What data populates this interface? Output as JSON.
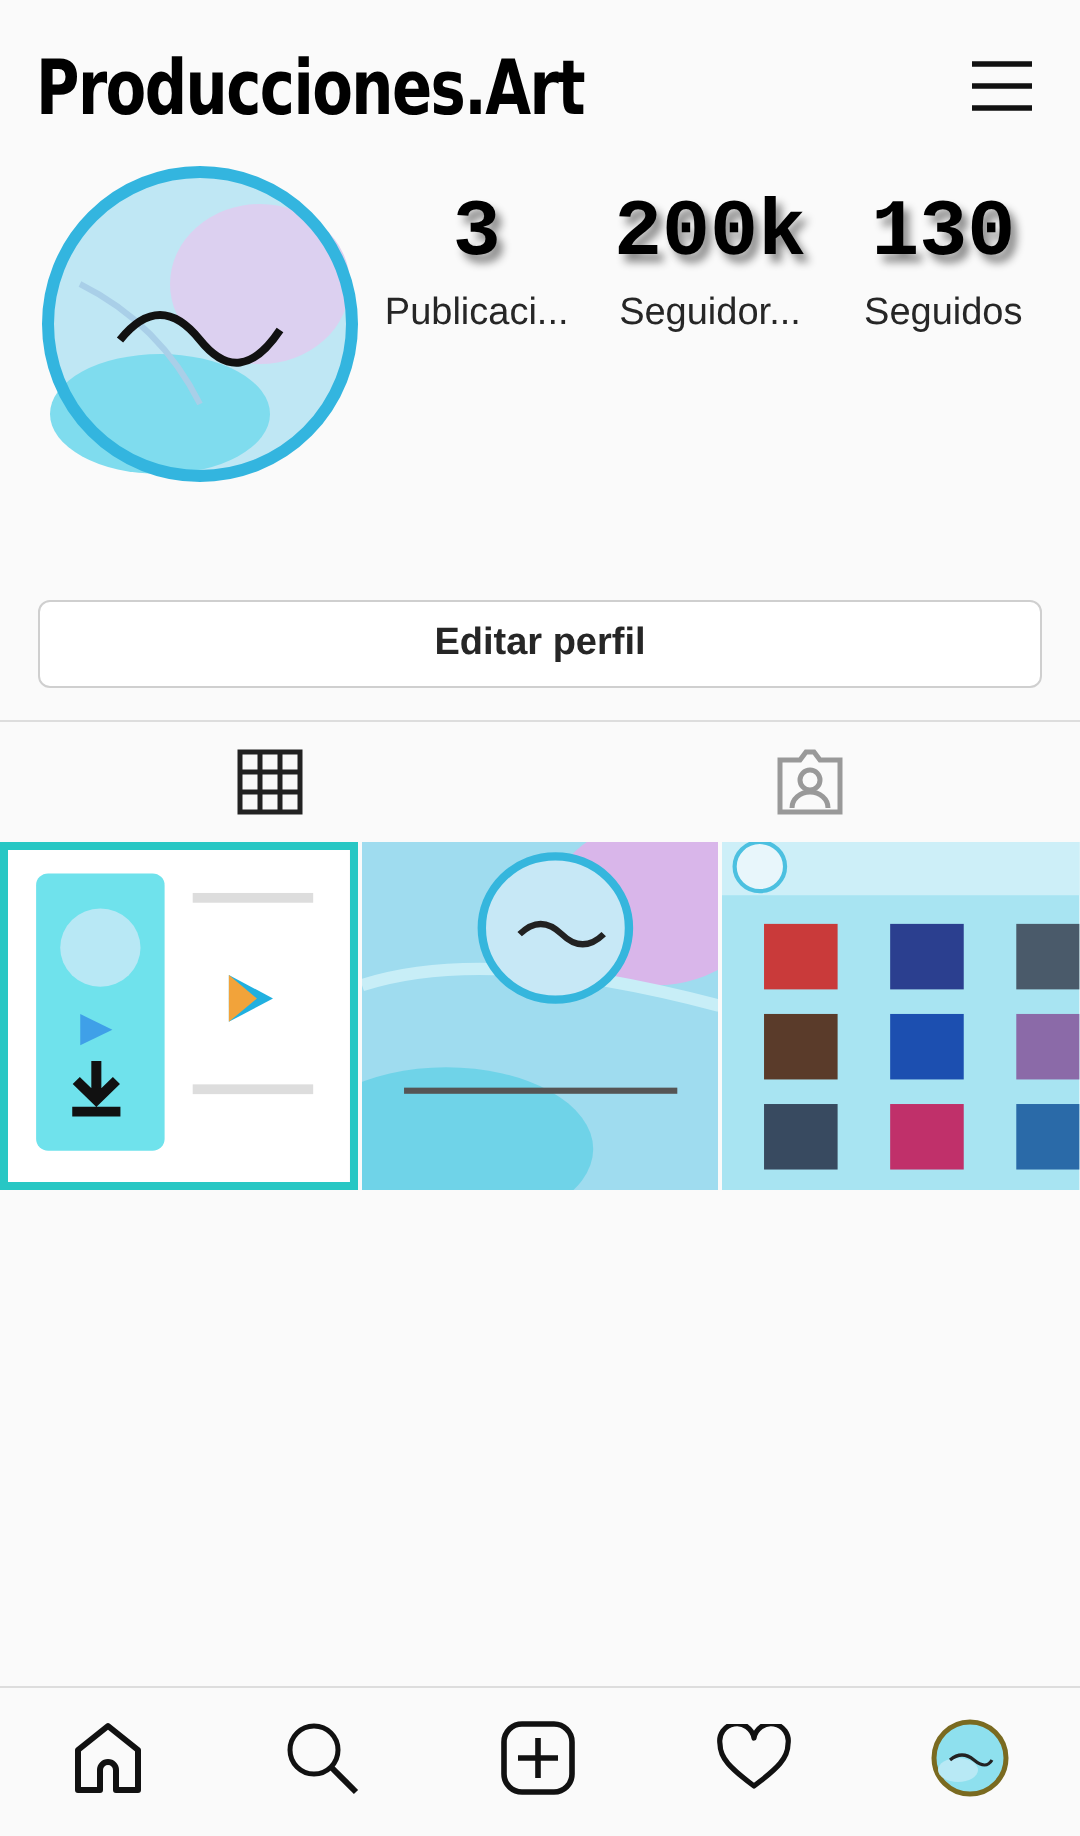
{
  "header": {
    "username": "Producciones.Art"
  },
  "stats": [
    {
      "value": "3",
      "label": "Publicaci..."
    },
    {
      "value": "200k",
      "label": "Seguidor..."
    },
    {
      "value": "130",
      "label": "Seguidos"
    }
  ],
  "edit_button": "Editar perfil",
  "tabs": [
    {
      "kind": "grid",
      "selected": true
    },
    {
      "kind": "tagged",
      "selected": false
    }
  ],
  "posts": [
    {
      "kind": "picture",
      "selected": true
    },
    {
      "kind": "picture",
      "selected": false
    },
    {
      "kind": "picture",
      "selected": false
    }
  ],
  "bottom_nav": [
    {
      "kind": "home"
    },
    {
      "kind": "search"
    },
    {
      "kind": "add"
    },
    {
      "kind": "activity"
    },
    {
      "kind": "profile"
    }
  ]
}
